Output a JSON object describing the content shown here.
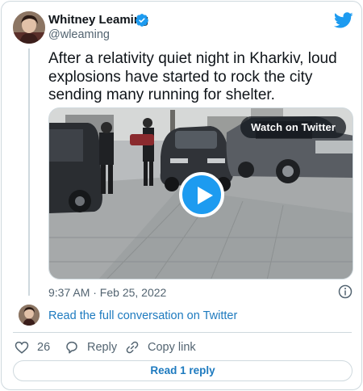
{
  "author": {
    "name": "Whitney Leaming",
    "handle": "@wleaming",
    "verified": true
  },
  "icons": {
    "brand": "twitter-bird-icon",
    "verified": "verified-badge-icon",
    "play": "play-icon",
    "info": "info-icon",
    "like": "heart-icon",
    "reply": "speech-bubble-icon",
    "copy": "link-icon"
  },
  "tweet": {
    "text": "After a relativity quiet night in Kharkiv, loud explosions have started to rock the city sending many running for shelter.",
    "timestamp": "9:37 AM · Feb 25, 2022"
  },
  "media": {
    "watch_label": "Watch on Twitter"
  },
  "conversation_link": "Read the full conversation on Twitter",
  "actions": {
    "like_count": "26",
    "reply_label": "Reply",
    "copy_label": "Copy link"
  },
  "read_replies_label": "Read 1 reply",
  "colors": {
    "brand": "#1d9bf0",
    "link": "#1d7abf",
    "text": "#0f1419",
    "muted": "#536471",
    "border": "#cfd9de"
  }
}
